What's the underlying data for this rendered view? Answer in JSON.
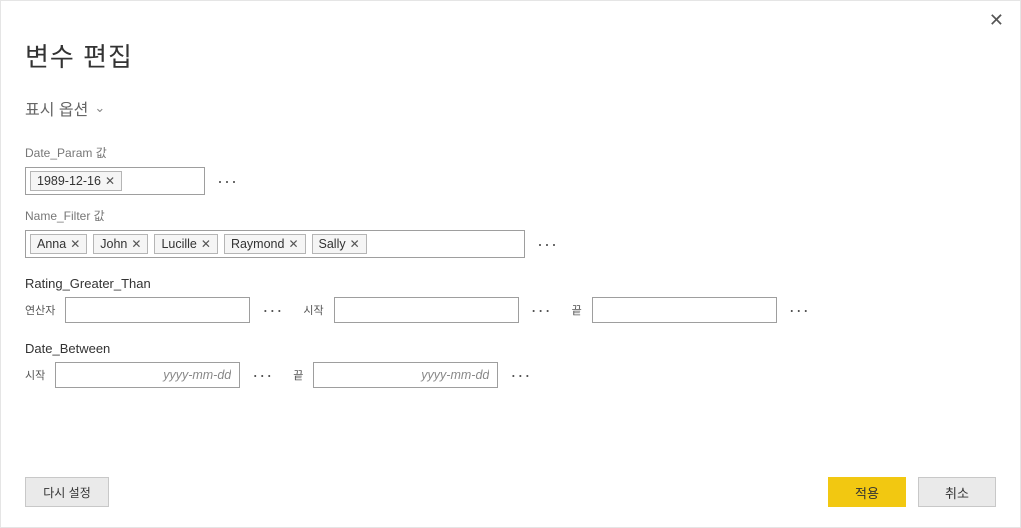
{
  "dialog": {
    "title": "변수 편집",
    "close_label": "✕"
  },
  "display_options": {
    "label": "표시 옵션",
    "chevron": "⌄"
  },
  "params": {
    "date_param": {
      "label": "Date_Param 값",
      "tokens": [
        "1989-12-16"
      ]
    },
    "name_filter": {
      "label": "Name_Filter 값",
      "tokens": [
        "Anna",
        "John",
        "Lucille",
        "Raymond",
        "Sally"
      ]
    },
    "rating_gt": {
      "label": "Rating_Greater_Than",
      "operator_label": "연산자",
      "start_label": "시작",
      "end_label": "끝",
      "operator_value": "",
      "start_value": "",
      "end_value": ""
    },
    "date_between": {
      "label": "Date_Between",
      "start_label": "시작",
      "end_label": "끝",
      "start_value": "",
      "end_value": "",
      "placeholder": "yyyy-mm-dd"
    }
  },
  "ellipsis": "···",
  "token_x": "✕",
  "footer": {
    "reset": "다시 설정",
    "apply": "적용",
    "cancel": "취소"
  }
}
